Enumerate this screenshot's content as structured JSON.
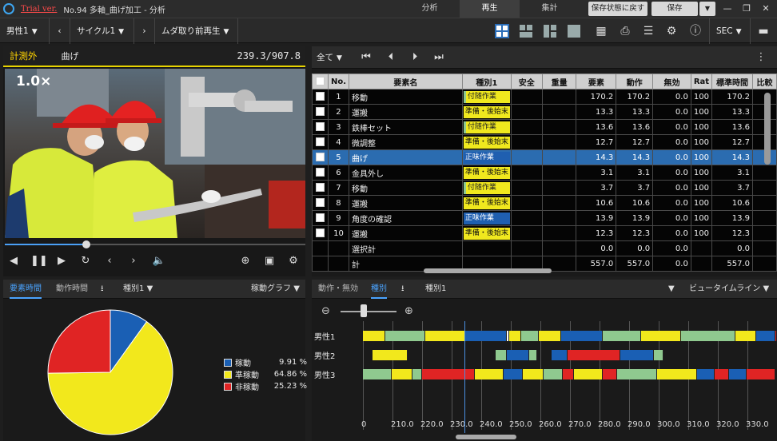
{
  "titlebar": {
    "trial": "Trial ver.",
    "title": "No.94 多軸_曲げ加工 - 分析",
    "tabs": [
      "分析",
      "再生",
      "集計"
    ],
    "active_tab": 1,
    "restore_label": "保存状態に戻す",
    "save_label": "保存"
  },
  "toolbar": {
    "operator": "男性1",
    "cycle": "サイクル1",
    "mode": "ムダ取り前再生",
    "unit": "SEC"
  },
  "video": {
    "status": "計測外",
    "element": "曲げ",
    "time": "239.3/907.8",
    "speed": "1.0×",
    "progress": 0.27
  },
  "table": {
    "filter": "全て",
    "headers": [
      "No.",
      "要素名",
      "種別1",
      "安全",
      "重量",
      "要素",
      "動作",
      "無効",
      "Rat",
      "標準時間",
      "比較"
    ],
    "rows": [
      {
        "no": "1",
        "name": "移動",
        "kind": "付随作業",
        "v1": "170.2",
        "v2": "170.2",
        "v3": "0.0",
        "rat": "100",
        "std": "170.2"
      },
      {
        "no": "2",
        "name": "運搬",
        "kind": "準備・後始末",
        "v1": "13.3",
        "v2": "13.3",
        "v3": "0.0",
        "rat": "100",
        "std": "13.3"
      },
      {
        "no": "3",
        "name": "鉄棒セット",
        "kind": "付随作業",
        "v1": "13.6",
        "v2": "13.6",
        "v3": "0.0",
        "rat": "100",
        "std": "13.6"
      },
      {
        "no": "4",
        "name": "微調整",
        "kind": "準備・後始末",
        "v1": "12.7",
        "v2": "12.7",
        "v3": "0.0",
        "rat": "100",
        "std": "12.7"
      },
      {
        "no": "5",
        "name": "曲げ",
        "kind": "正味作業",
        "v1": "14.3",
        "v2": "14.3",
        "v3": "0.0",
        "rat": "100",
        "std": "14.3"
      },
      {
        "no": "6",
        "name": "金具外し",
        "kind": "準備・後始末",
        "v1": "3.1",
        "v2": "3.1",
        "v3": "0.0",
        "rat": "100",
        "std": "3.1"
      },
      {
        "no": "7",
        "name": "移動",
        "kind": "付随作業",
        "v1": "3.7",
        "v2": "3.7",
        "v3": "0.0",
        "rat": "100",
        "std": "3.7"
      },
      {
        "no": "8",
        "name": "運搬",
        "kind": "準備・後始末",
        "v1": "10.6",
        "v2": "10.6",
        "v3": "0.0",
        "rat": "100",
        "std": "10.6"
      },
      {
        "no": "9",
        "name": "角度の確認",
        "kind": "正味作業",
        "v1": "13.9",
        "v2": "13.9",
        "v3": "0.0",
        "rat": "100",
        "std": "13.9"
      },
      {
        "no": "10",
        "name": "運搬",
        "kind": "準備・後始末",
        "v1": "12.3",
        "v2": "12.3",
        "v3": "0.0",
        "rat": "100",
        "std": "12.3"
      }
    ],
    "selected_row": 4,
    "selection_total": {
      "label": "選択計",
      "v1": "0.0",
      "v2": "0.0",
      "v3": "0.0",
      "std": "0.0"
    },
    "total": {
      "label": "計",
      "v1": "557.0",
      "v2": "557.0",
      "v3": "0.0",
      "std": "557.0"
    }
  },
  "chart_panel": {
    "tab1": "要素時間",
    "tab2": "動作時間",
    "kind": "種別1",
    "graph": "稼動グラフ"
  },
  "chart_data": {
    "type": "pie",
    "slices": [
      {
        "name": "稼動",
        "value": 9.91,
        "label": "9.91 %",
        "color": "#1a5fb4"
      },
      {
        "name": "準稼動",
        "value": 64.86,
        "label": "64.86 %",
        "color": "#f2e81c"
      },
      {
        "name": "非稼動",
        "value": 25.23,
        "label": "25.23 %",
        "color": "#e02424"
      }
    ]
  },
  "timeline": {
    "tab1": "動作・無効",
    "tab2": "種別",
    "kind": "種別1",
    "view": "ビュータイムライン",
    "operators": [
      "男性1",
      "男性2",
      "男性3"
    ],
    "ticks": [
      "0",
      "210.0",
      "220.0",
      "230.0",
      "240.0",
      "250.0",
      "260.0",
      "270.0",
      "280.0",
      "290.0",
      "300.0",
      "310.0",
      "320.0",
      "330.0"
    ]
  },
  "colors": {
    "accent": "#4aa3ff",
    "net": "#1a5fb4",
    "prep": "#f2e81c",
    "non": "#e02424",
    "aux": "#8fc98f"
  }
}
